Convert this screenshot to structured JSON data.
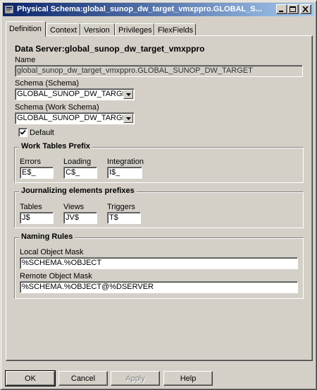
{
  "window": {
    "title": "Physical Schema:global_sunop_dw_target_vmxppro.GLOBAL_S..."
  },
  "tabs": [
    {
      "label": "Definition",
      "active": true
    },
    {
      "label": "Context",
      "active": false
    },
    {
      "label": "Version",
      "active": false
    },
    {
      "label": "Privileges",
      "active": false
    },
    {
      "label": "FlexFields",
      "active": false
    }
  ],
  "definition": {
    "data_server_heading": "Data Server:global_sunop_dw_target_vmxppro",
    "name_label": "Name",
    "name_value": "global_sunop_dw_target_vmxppro.GLOBAL_SUNOP_DW_TARGET",
    "schema_label": "Schema (Schema)",
    "schema_value": "GLOBAL_SUNOP_DW_TARGET",
    "work_schema_label": "Schema (Work Schema)",
    "work_schema_value": "GLOBAL_SUNOP_DW_TARGET",
    "default_label": "Default",
    "default_checked": true
  },
  "work_tables": {
    "title": "Work Tables Prefix",
    "errors_label": "Errors",
    "errors_value": "E$_",
    "loading_label": "Loading",
    "loading_value": "C$_",
    "integration_label": "Integration",
    "integration_value": "I$_"
  },
  "journalizing": {
    "title": "Journalizing elements prefixes",
    "tables_label": "Tables",
    "tables_value": "J$",
    "views_label": "Views",
    "views_value": "JV$",
    "triggers_label": "Triggers",
    "triggers_value": "T$"
  },
  "naming": {
    "title": "Naming Rules",
    "local_label": "Local Object Mask",
    "local_value": "%SCHEMA.%OBJECT",
    "remote_label": "Remote Object Mask",
    "remote_value": "%SCHEMA.%OBJECT@%DSERVER"
  },
  "buttons": {
    "ok": "OK",
    "cancel": "Cancel",
    "apply": "Apply",
    "help": "Help"
  }
}
